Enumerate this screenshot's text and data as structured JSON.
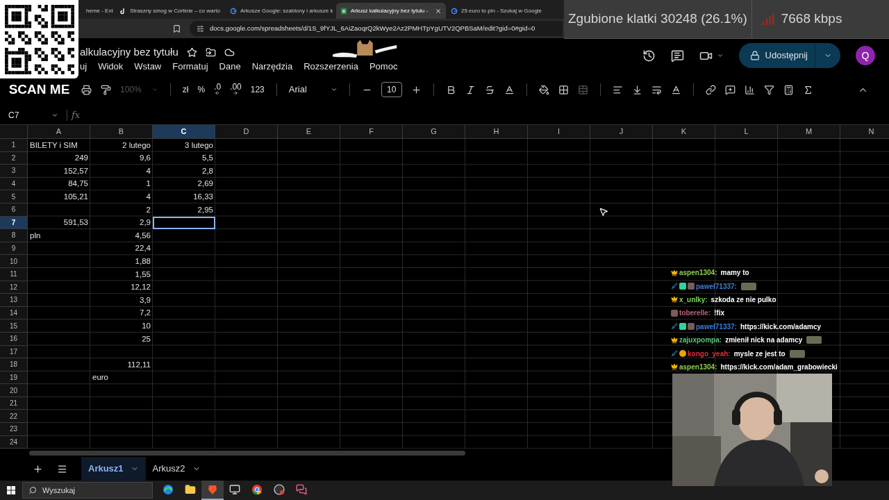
{
  "browser": {
    "tabs": [
      {
        "title": "heme - Ext",
        "selected": false
      },
      {
        "title": "Straszny smog w Cortinie – co warto",
        "selected": false
      },
      {
        "title": "Arkusze Google: szablony i arkusze k",
        "selected": false
      },
      {
        "title": "Arkusz kalkulacyjny bez tytułu - ",
        "selected": true
      },
      {
        "title": "25 euro to pln - Szukaj w Google",
        "selected": false
      }
    ],
    "url": "docs.google.com/spreadsheets/d/1S_9fYJL_6AiZaoqrQ2kWye2Az2PMHTpYgUTV2QPBSaM/edit?gid=0#gid=0"
  },
  "stream_stats": {
    "dropped_frames": "Zgubione klatki 30248 (26.1%)",
    "bitrate": "7668 kbps"
  },
  "qr_overlay": {
    "caption": "SCAN ME"
  },
  "doc": {
    "title": "alkulacyjny bez tytułu",
    "menu": [
      "uj",
      "Widok",
      "Wstaw",
      "Formatuj",
      "Dane",
      "Narzędzia",
      "Rozszerzenia",
      "Pomoc"
    ],
    "share_button": "Udostępnij",
    "avatar": "Q"
  },
  "toolbar": {
    "zoom": {
      "value": "100%",
      "disabled": true
    },
    "currency": "zł",
    "percent": "%",
    "decrease_decimals": ".0",
    "increase_decimals": ".00",
    "number_format": "123",
    "font": "Arial",
    "font_size": "10"
  },
  "formula_bar": {
    "name_box": "C7",
    "fx": "fx"
  },
  "sheet": {
    "columns": [
      {
        "label": "A",
        "selected": false
      },
      {
        "label": "B",
        "selected": false
      },
      {
        "label": "C",
        "selected": true
      },
      {
        "label": "D",
        "selected": false
      },
      {
        "label": "E",
        "selected": false
      },
      {
        "label": "F",
        "selected": false
      },
      {
        "label": "G",
        "selected": false
      },
      {
        "label": "H",
        "selected": false
      },
      {
        "label": "I",
        "selected": false
      },
      {
        "label": "J",
        "selected": false
      },
      {
        "label": "K",
        "selected": false
      },
      {
        "label": "L",
        "selected": false
      },
      {
        "label": "M",
        "selected": false
      },
      {
        "label": "N",
        "selected": false
      }
    ],
    "rows": [
      {
        "label": "1",
        "selected": false,
        "cells": [
          {
            "text": "BILETY i SIM",
            "kind": "text"
          },
          {
            "text": "2 lutego",
            "kind": "date"
          },
          {
            "text": "3 lutego",
            "kind": "date"
          }
        ]
      },
      {
        "label": "2",
        "selected": false,
        "cells": [
          {
            "text": "249",
            "kind": "number"
          },
          {
            "text": "9,6",
            "kind": "number"
          },
          {
            "text": "5,5",
            "kind": "number"
          }
        ]
      },
      {
        "label": "3",
        "selected": false,
        "cells": [
          {
            "text": "152,57",
            "kind": "number"
          },
          {
            "text": "4",
            "kind": "number"
          },
          {
            "text": "2,8",
            "kind": "number"
          }
        ]
      },
      {
        "label": "4",
        "selected": false,
        "cells": [
          {
            "text": "84,75",
            "kind": "number"
          },
          {
            "text": "1",
            "kind": "number"
          },
          {
            "text": "2,69",
            "kind": "number"
          }
        ]
      },
      {
        "label": "5",
        "selected": false,
        "cells": [
          {
            "text": "105,21",
            "kind": "number"
          },
          {
            "text": "4",
            "kind": "number"
          },
          {
            "text": "16,33",
            "kind": "number"
          }
        ]
      },
      {
        "label": "6",
        "selected": false,
        "cells": [
          null,
          {
            "text": "2",
            "kind": "number"
          },
          {
            "text": "2,95",
            "kind": "number"
          }
        ]
      },
      {
        "label": "7",
        "selected": true,
        "cells": [
          {
            "text": "591,53",
            "kind": "number"
          },
          {
            "text": "2,9",
            "kind": "number"
          }
        ]
      },
      {
        "label": "8",
        "selected": false,
        "cells": [
          {
            "text": "pln",
            "kind": "text"
          },
          {
            "text": "4,56",
            "kind": "number"
          }
        ]
      },
      {
        "label": "9",
        "selected": false,
        "cells": [
          null,
          {
            "text": "22,4",
            "kind": "number"
          }
        ]
      },
      {
        "label": "10",
        "selected": false,
        "cells": [
          null,
          {
            "text": "1,88",
            "kind": "number"
          }
        ]
      },
      {
        "label": "11",
        "selected": false,
        "cells": [
          null,
          {
            "text": "1,55",
            "kind": "number"
          }
        ]
      },
      {
        "label": "12",
        "selected": false,
        "cells": [
          null,
          {
            "text": "12,12",
            "kind": "number"
          }
        ]
      },
      {
        "label": "13",
        "selected": false,
        "cells": [
          null,
          {
            "text": "3,9",
            "kind": "number"
          }
        ]
      },
      {
        "label": "14",
        "selected": false,
        "cells": [
          null,
          {
            "text": "7,2",
            "kind": "number"
          }
        ]
      },
      {
        "label": "15",
        "selected": false,
        "cells": [
          null,
          {
            "text": "10",
            "kind": "number"
          }
        ]
      },
      {
        "label": "16",
        "selected": false,
        "cells": [
          null,
          {
            "text": "25",
            "kind": "number"
          }
        ]
      },
      {
        "label": "17",
        "selected": false,
        "cells": []
      },
      {
        "label": "18",
        "selected": false,
        "cells": [
          null,
          {
            "text": "112,11",
            "kind": "number"
          }
        ]
      },
      {
        "label": "19",
        "selected": false,
        "cells": [
          null,
          {
            "text": "euro",
            "kind": "text"
          }
        ]
      },
      {
        "label": "20",
        "selected": false,
        "cells": []
      },
      {
        "label": "21",
        "selected": false,
        "cells": []
      },
      {
        "label": "22",
        "selected": false,
        "cells": []
      },
      {
        "label": "23",
        "selected": false,
        "cells": []
      },
      {
        "label": "24",
        "selected": false,
        "cells": []
      }
    ]
  },
  "sheet_tabs": [
    {
      "label": "Arkusz1",
      "selected": true
    },
    {
      "label": "Arkusz2",
      "selected": false
    }
  ],
  "chat": [
    {
      "user": "aspen1304:",
      "color": "#8fd14f",
      "text": "mamy to",
      "emote": false
    },
    {
      "user": "pawel71337:",
      "color": "#3b7dd8",
      "emote": true
    },
    {
      "user": "x_unlky:",
      "color": "#7ed957",
      "text": "szkoda ze nie pulko",
      "emote": false
    },
    {
      "user": "toberelle:",
      "color": "#c0607a",
      "text": "!fix",
      "emote": false
    },
    {
      "user": "pawel71337:",
      "color": "#3b7dd8",
      "text": "https://kick.com/adamcy",
      "emote": false
    },
    {
      "user": "zajuxpompa:",
      "color": "#59c97a",
      "text": "zmienił nick na adamcy",
      "emote": true
    },
    {
      "user": "kongo_yeah:",
      "color": "#e0303a",
      "text": "mysle ze jest to",
      "emote": true
    },
    {
      "user": "aspen1304:",
      "color": "#8fd14f",
      "text": "https://kick.com/adam_grabowiecki",
      "emote": false
    }
  ],
  "taskbar": {
    "search": "Wyszukaj",
    "apps": [
      {
        "selected": false
      },
      {
        "selected": false
      },
      {
        "selected": true
      },
      {
        "selected": false
      },
      {
        "selected": false
      },
      {
        "selected": false
      },
      {
        "selected": false
      }
    ]
  }
}
